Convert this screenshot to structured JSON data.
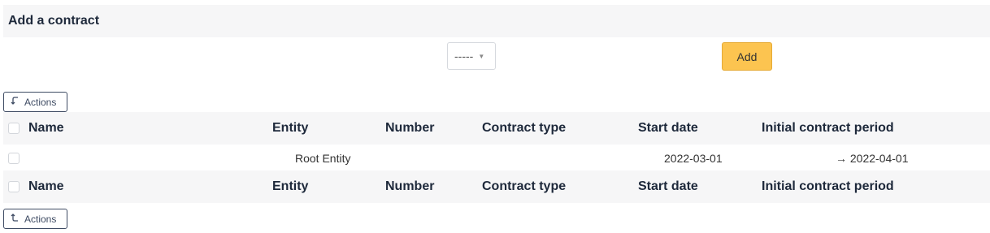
{
  "add_contract": {
    "title": "Add a contract",
    "select_value": "-----",
    "add_label": "Add"
  },
  "actions_label": "Actions",
  "table": {
    "columns": [
      "Name",
      "Entity",
      "Number",
      "Contract type",
      "Start date",
      "Initial contract period"
    ],
    "rows": [
      {
        "name": "",
        "entity": "Root Entity",
        "number": "",
        "contract_type": "",
        "start_date": "2022-03-01",
        "initial_period": "→ 2022-04-01"
      }
    ]
  }
}
